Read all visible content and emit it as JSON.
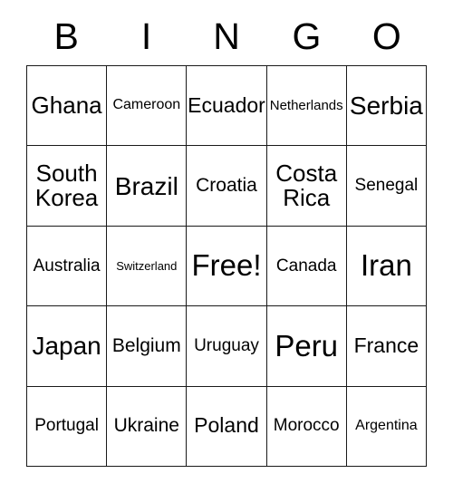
{
  "card": {
    "header_letters": [
      "B",
      "I",
      "N",
      "G",
      "O"
    ],
    "free_space_label": "Free!",
    "rows": [
      [
        {
          "label": "Ghana",
          "size": "fs-xl"
        },
        {
          "label": "Cameroon",
          "size": "fs-smd"
        },
        {
          "label": "Ecuador",
          "size": "fs-lg"
        },
        {
          "label": "Netherlands",
          "size": "fs-sm"
        },
        {
          "label": "Serbia",
          "size": "fs-xxl"
        }
      ],
      [
        {
          "label": "South\nKorea",
          "size": "fs-xl"
        },
        {
          "label": "Brazil",
          "size": "fs-xxl"
        },
        {
          "label": "Croatia",
          "size": "fs-mdl"
        },
        {
          "label": "Costa\nRica",
          "size": "fs-xl"
        },
        {
          "label": "Senegal",
          "size": "fs-md"
        }
      ],
      [
        {
          "label": "Australia",
          "size": "fs-md"
        },
        {
          "label": "Switzerland",
          "size": "fs-xs"
        },
        {
          "label": "Free!",
          "size": "fs-huge"
        },
        {
          "label": "Canada",
          "size": "fs-md"
        },
        {
          "label": "Iran",
          "size": "fs-huge"
        }
      ],
      [
        {
          "label": "Japan",
          "size": "fs-xxl"
        },
        {
          "label": "Belgium",
          "size": "fs-mdl"
        },
        {
          "label": "Uruguay",
          "size": "fs-md"
        },
        {
          "label": "Peru",
          "size": "fs-huge"
        },
        {
          "label": "France",
          "size": "fs-lg"
        }
      ],
      [
        {
          "label": "Portugal",
          "size": "fs-md"
        },
        {
          "label": "Ukraine",
          "size": "fs-mdl"
        },
        {
          "label": "Poland",
          "size": "fs-lg"
        },
        {
          "label": "Morocco",
          "size": "fs-md"
        },
        {
          "label": "Argentina",
          "size": "fs-smd"
        }
      ]
    ]
  },
  "colors": {
    "border": "#1a1a1a",
    "text": "#000000",
    "background": "#ffffff"
  }
}
